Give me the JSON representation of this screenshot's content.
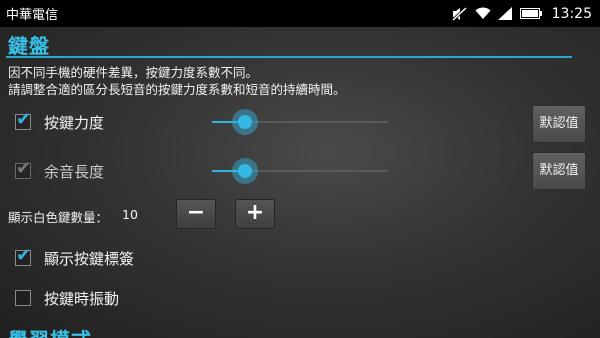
{
  "status_bar": {
    "carrier": "中華電信",
    "time": "13:25",
    "icons": [
      "sound-off-icon",
      "wifi-icon",
      "signal-icon",
      "battery-icon"
    ]
  },
  "keyboard_section": {
    "title": "鍵盤",
    "description_line1": "因不同手機的硬件差異，按鍵力度系數不同。",
    "description_line2": "請調整合適的區分長短音的按鍵力度系數和短音的持續時間。"
  },
  "key_force": {
    "label": "按鍵力度",
    "checked": true,
    "enabled": true,
    "slider_level": 0.19,
    "default_label": "默認值"
  },
  "sustain_length": {
    "label": "余音長度",
    "checked": true,
    "enabled": false,
    "slider_level": 0.19,
    "default_label": "默認值"
  },
  "white_keys": {
    "label": "顯示白色鍵數量：",
    "value": "10",
    "minus_label": "−",
    "plus_label": "+"
  },
  "show_key_labels": {
    "label": "顯示按鍵標簽",
    "checked": true
  },
  "key_vibration": {
    "label": "按鍵時振動",
    "checked": false
  },
  "learning_section": {
    "title": "學習模式"
  },
  "colors": {
    "accent": "#33b5e5",
    "status_bar": "#000000"
  }
}
